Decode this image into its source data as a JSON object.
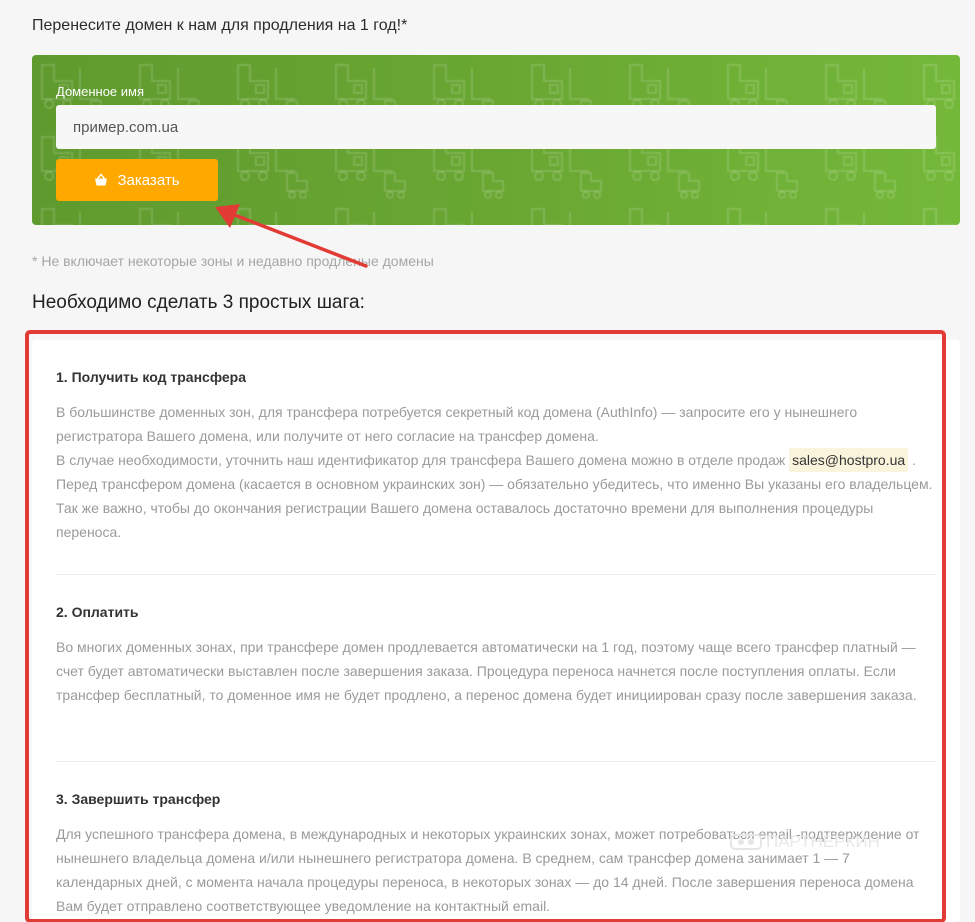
{
  "intro": {
    "text": "Перенесите домен к нам для продления на 1 год!*"
  },
  "transfer_form": {
    "field_label": "Доменное имя",
    "input_placeholder": "пример.com.ua",
    "order_button_label": "Заказать",
    "order_button_icon": "basket-icon",
    "panel_color": "#6aa833",
    "button_color": "#ffa800"
  },
  "footnote": "* Не включает некоторые зоны и недавно продленые домены",
  "steps_heading": "Необходимо сделать 3 простых шага:",
  "steps": [
    {
      "title": "1. Получить код трансфера",
      "paragraph_1": "В большинстве доменных зон, для трансфера потребуется секретный код домена (AuthInfo) — запросите его у нынешнего регистратора Вашего домена, или получите от него согласие на трансфер домена.",
      "paragraph_2_before": "В случае необходимости, уточнить наш идентификатор для трансфера Вашего домена можно в отделе продаж",
      "email": "sales@hostpro.ua",
      "paragraph_2_after": ". Перед трансфером домена (касается в основном украинских зон) — обязательно убедитесь, что именно Вы указаны его владельцем. Так же важно, чтобы до окончания регистрации Вашего домена оставалось достаточно времени для выполнения процедуры переноса."
    },
    {
      "title": "2. Оплатить",
      "paragraph_1": "Во многих доменных зонах, при трансфере домен продлевается автоматически на 1 год, поэтому чаще всего трансфер платный — счет будет автоматически выставлен после завершения заказа. Процедура переноса начнется после поступления оплаты. Если трансфер бесплатный, то доменное имя не будет продлено, а перенос домена будет инициирован сразу после завершения заказа."
    },
    {
      "title": "3. Завершить трансфер",
      "paragraph_1": "Для успешного трансфера домена, в международных и некоторых украинских зонах, может потребоваться email -подтверждение от нынешнего владельца домена и/или нынешнего регистратора домена. В среднем, сам трансфер домена занимает 1 — 7 календарных дней, с момента начала процедуры переноса, в некоторых зонах — до 14 дней. После завершения переноса домена Вам будет отправлено соответствующее уведомление на контактный email."
    }
  ],
  "annotation": {
    "highlight_color": "#e23b35",
    "arrow_color": "#e23b35"
  },
  "watermark": {
    "text": "ПАРТНЕРКИН"
  }
}
